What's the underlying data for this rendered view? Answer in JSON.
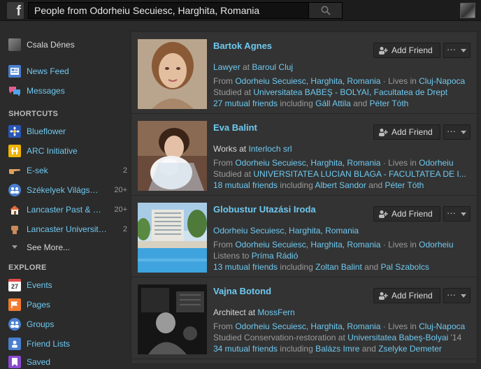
{
  "topbar": {
    "logo_letter": "f",
    "search_value": "People from Odorheiu Secuiesc, Harghita, Romania"
  },
  "sidebar": {
    "user_name": "Csala Dénes",
    "main_items": [
      {
        "label": "News Feed",
        "icon": "news-feed-icon"
      },
      {
        "label": "Messages",
        "icon": "messages-icon"
      }
    ],
    "shortcuts_header": "SHORTCUTS",
    "shortcuts": [
      {
        "label": "Blueflower",
        "count": ""
      },
      {
        "label": "ARC Initiative",
        "count": ""
      },
      {
        "label": "E-sek",
        "count": "2"
      },
      {
        "label": "Székelyek Világs…",
        "count": "20+"
      },
      {
        "label": "Lancaster Past & …",
        "count": "20+"
      },
      {
        "label": "Lancaster Universit…",
        "count": "2"
      },
      {
        "label": "See More...",
        "count": ""
      }
    ],
    "explore_header": "EXPLORE",
    "explore": [
      {
        "label": "Events"
      },
      {
        "label": "Pages"
      },
      {
        "label": "Groups"
      },
      {
        "label": "Friend Lists"
      },
      {
        "label": "Saved"
      }
    ],
    "events_icon_number": "27"
  },
  "results": {
    "add_friend_label": "Add Friend",
    "more_label": "···",
    "items": [
      {
        "name": "Bartok Agnes",
        "line1": {
          "a": "Lawyer",
          "b": " at ",
          "c": "Baroul Cluj"
        },
        "line2": {
          "a": "From ",
          "b": "Odorheiu Secuiesc, Harghita, Romania",
          "c": " · Lives in ",
          "d": "Cluj-Napoca"
        },
        "line3": {
          "a": "Studied at ",
          "b": "Universitatea BABEŞ - BOLYAI, Facultatea de Drept"
        },
        "line4": {
          "a": "27 mutual friends",
          "b": " including ",
          "c": "Gáll Attila",
          "d": " and ",
          "e": "Péter Tóth"
        }
      },
      {
        "name": "Eva Balint",
        "line1": {
          "a": "Works at ",
          "b": "Interloch srl"
        },
        "line2": {
          "a": "From ",
          "b": "Odorheiu Secuiesc, Harghita, Romania",
          "c": " · Lives in ",
          "d": "Odorheiu"
        },
        "line3": {
          "a": "Studied at ",
          "b": "UNIVERSITATEA LUCIAN BLAGA - FACULTATEA DE I..."
        },
        "line4": {
          "a": "18 mutual friends",
          "b": " including ",
          "c": "Albert Sandor",
          "d": " and ",
          "e": "Péter Tóth"
        }
      },
      {
        "name": "Globustur Utazási Iroda",
        "line1": {
          "a": "Odorheiu Secuiesc, Harghita, Romania"
        },
        "line2": {
          "a": "From ",
          "b": "Odorheiu Secuiesc, Harghita, Romania",
          "c": " · Lives in ",
          "d": "Odorheiu"
        },
        "line3": {
          "a": "Listens to ",
          "b": "Príma Rádió"
        },
        "line4": {
          "a": "13 mutual friends",
          "b": " including ",
          "c": "Zoltan Balint",
          "d": " and ",
          "e": "Pal Szabolcs"
        }
      },
      {
        "name": "Vajna Botond",
        "line1": {
          "a": "Architect",
          "b": " at ",
          "c": "MossFern"
        },
        "line2": {
          "a": "From ",
          "b": "Odorheiu Secuiesc, Harghita, Romania",
          "c": " · Lives in ",
          "d": "Cluj-Napoca"
        },
        "line3": {
          "a": "Studied Conservation-restoration at ",
          "b": "Universitatea Babeş-Bolyai",
          "c": " '14"
        },
        "line4": {
          "a": "34 mutual friends",
          "b": " including ",
          "c": "Balázs Imre",
          "d": " and ",
          "e": "Zselyke Demeter"
        }
      }
    ]
  },
  "colors": {
    "link": "#6fc9f0",
    "background": "#2b2b2b",
    "panel": "#333333"
  }
}
